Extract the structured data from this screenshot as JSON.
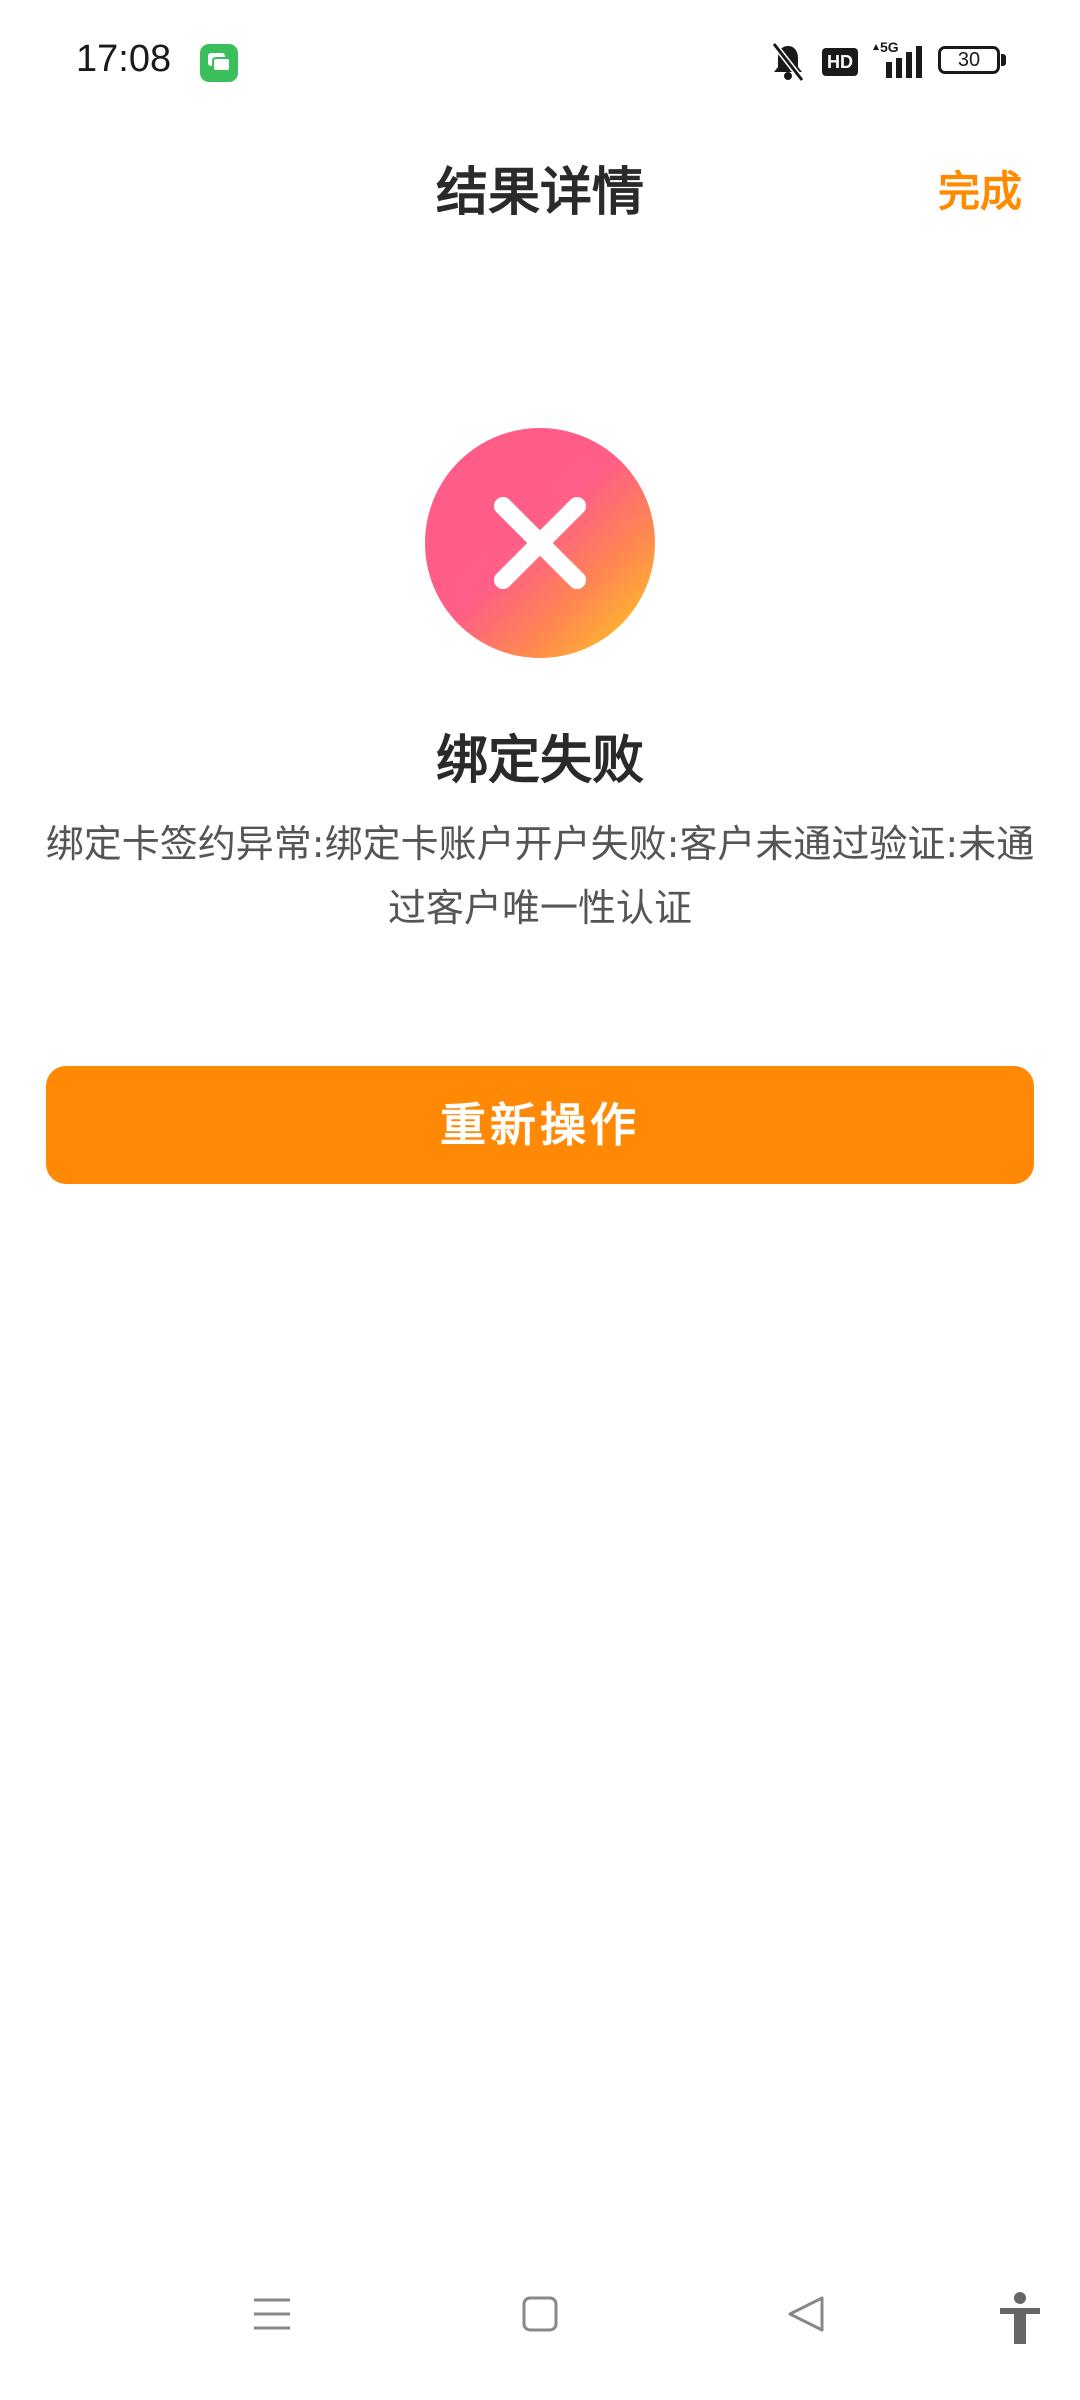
{
  "status_bar": {
    "time": "17:08",
    "app_icon": "message-app-icon",
    "hd_label": "HD",
    "network_label": "5G",
    "battery_level": "30"
  },
  "nav": {
    "title": "结果详情",
    "done_label": "完成"
  },
  "result": {
    "status": "failure",
    "icon": "close-icon",
    "title": "绑定失败",
    "description": "绑定卡签约异常:绑定卡账户开户失败:客户未通过验证:未通过客户唯一性认证"
  },
  "retry_button": {
    "label": "重新操作"
  },
  "system_nav": {
    "items": [
      "menu-icon",
      "home-icon",
      "back-icon",
      "accessibility-icon"
    ]
  },
  "colors": {
    "accent": "#ff8804",
    "icon_gradient_start": "#ff5a8a",
    "icon_gradient_end": "#ffd21a",
    "title_text": "#2a2a2a",
    "body_text": "#555555"
  }
}
